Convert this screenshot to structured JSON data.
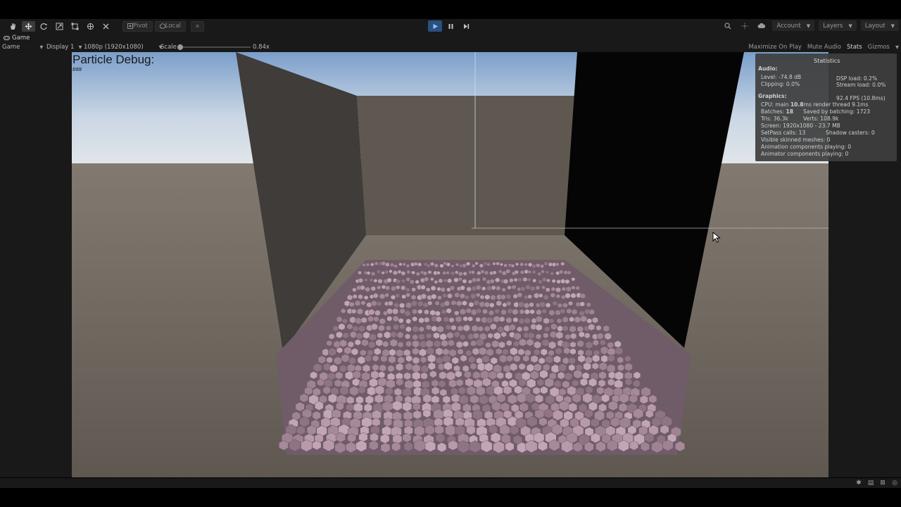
{
  "toolbar": {
    "tools": [
      "hand-tool",
      "move-tool",
      "rotate-tool",
      "scale-tool",
      "rect-tool",
      "transform-tool",
      "custom-tool"
    ],
    "pivot_label": "Pivot",
    "local_label": "Local",
    "account_label": "Account",
    "layers_label": "Layers",
    "layout_label": "Layout"
  },
  "tabbar": {
    "tab_label": "Game"
  },
  "controls": {
    "game_mode": "Game",
    "display": "Display 1",
    "resolution": "1080p (1920x1080)",
    "scale_label": "Scale",
    "scale_value": "0.84x",
    "scale_level": 0.0,
    "maximize_on_play": "Maximize On Play",
    "mute_audio": "Mute Audio",
    "stats": "Stats",
    "gizmos": "Gizmos"
  },
  "viewport": {
    "debug_title": "Particle Debug:",
    "debug_sub": "###"
  },
  "statistics": {
    "title": "Statistics",
    "audio_header": "Audio:",
    "level": "Level: -74.8 dB",
    "clipping": "Clipping: 0.0%",
    "dsp_load": "DSP load: 0.2%",
    "stream_load": "Stream load: 0.0%",
    "graphics_header": "Graphics:",
    "fps": "92.4 FPS (10.8ms)",
    "cpu_main_prefix": "CPU: main ",
    "cpu_main_value": "10.8",
    "cpu_main_suffix": "ms  render thread 9.1ms",
    "batches_prefix": "Batches: ",
    "batches_value": "18",
    "saved_by_batching": "Saved by batching: 1723",
    "tris": "Tris: 36.3k",
    "verts": "Verts: 108.9k",
    "screen": "Screen: 1920x1080 - 23.7 MB",
    "setpass": "SetPass calls: 13",
    "shadow_casters": "Shadow casters: 0",
    "skinned_meshes": "Visible skinned meshes: 0",
    "animation_components": "Animation components playing: 0",
    "animator_components": "Animator components playing: 0"
  },
  "colors": {
    "editor_bg": "#191919",
    "play_active": "#2a5080",
    "particle": "#a78a9a"
  }
}
